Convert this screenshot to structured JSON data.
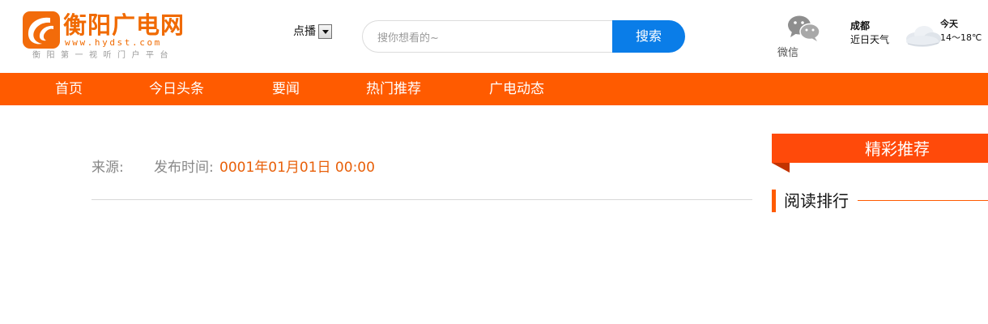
{
  "header": {
    "logo": {
      "name": "衡阳广电网",
      "url": "www.hydst.com",
      "slogan": "衡阳第一视听门户平台"
    },
    "vod": {
      "label": "点播"
    },
    "search": {
      "placeholder": "搜你想看的~",
      "button_label": "搜索"
    },
    "wechat": {
      "label": "微信",
      "icon": "wechat-icon"
    },
    "weather": {
      "city": "成都",
      "subtitle": "近日天气",
      "today_label": "今天",
      "temperature": "14～18℃",
      "icon": "cloudy-icon"
    }
  },
  "nav": {
    "items": [
      {
        "label": "首页"
      },
      {
        "label": "今日头条"
      },
      {
        "label": "要闻"
      },
      {
        "label": "热门推荐"
      },
      {
        "label": "广电动态"
      }
    ]
  },
  "article": {
    "source_label": "来源:",
    "time_label": "发布时间:",
    "time_value": "0001年01月01日 00:00"
  },
  "sidebar": {
    "recommend_title": "精彩推荐",
    "ranking_title": "阅读排行"
  },
  "colors": {
    "brand_orange": "#ff5b00",
    "search_blue": "#0a7de8",
    "recommend_red": "#ff4a0a",
    "time_orange": "#e8600a"
  }
}
